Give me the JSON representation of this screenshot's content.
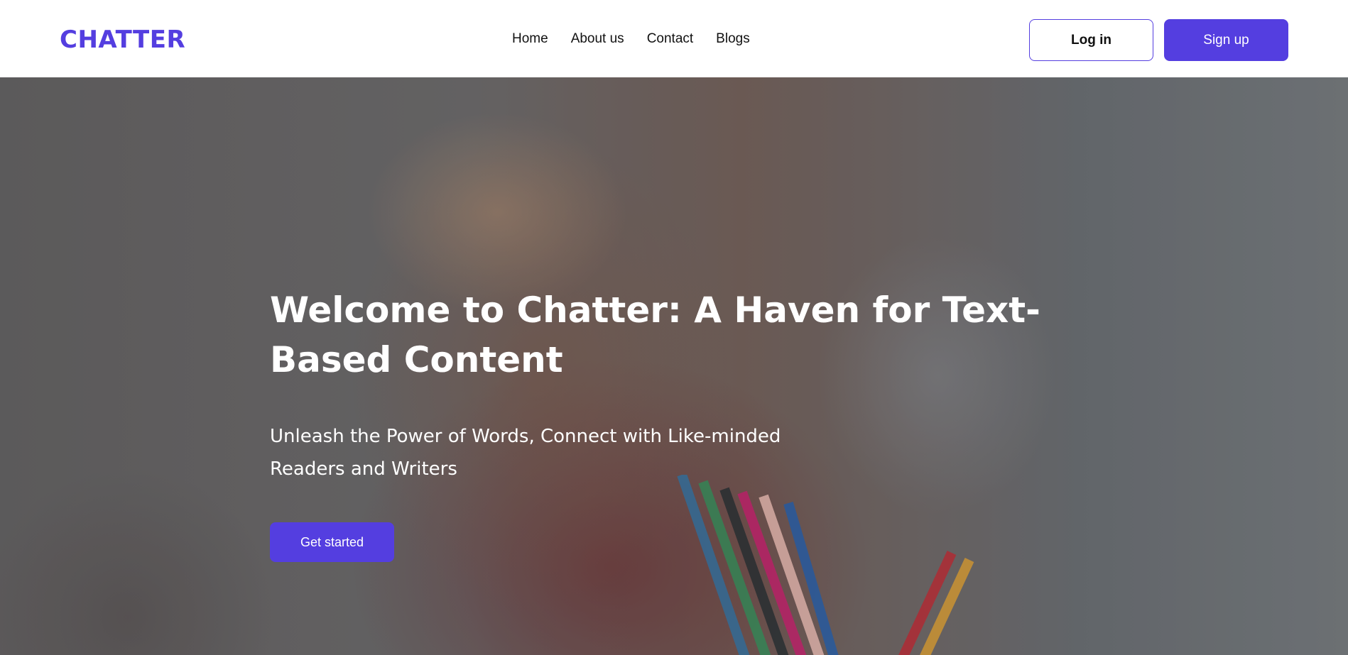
{
  "header": {
    "logo": "CHATTER",
    "nav": [
      "Home",
      "About us",
      "Contact",
      "Blogs"
    ],
    "login_label": "Log in",
    "signup_label": "Sign up"
  },
  "hero": {
    "title": "Welcome to Chatter: A Haven for Text-Based Content",
    "subtitle": "Unleash the Power of Words, Connect with Like-minded Readers and Writers",
    "cta_label": "Get started",
    "background_image": "woman-with-glasses-biting-pencil-photo"
  },
  "colors": {
    "brand": "#543ee0",
    "header_bg": "#ffffff",
    "hero_text": "#ffffff"
  }
}
